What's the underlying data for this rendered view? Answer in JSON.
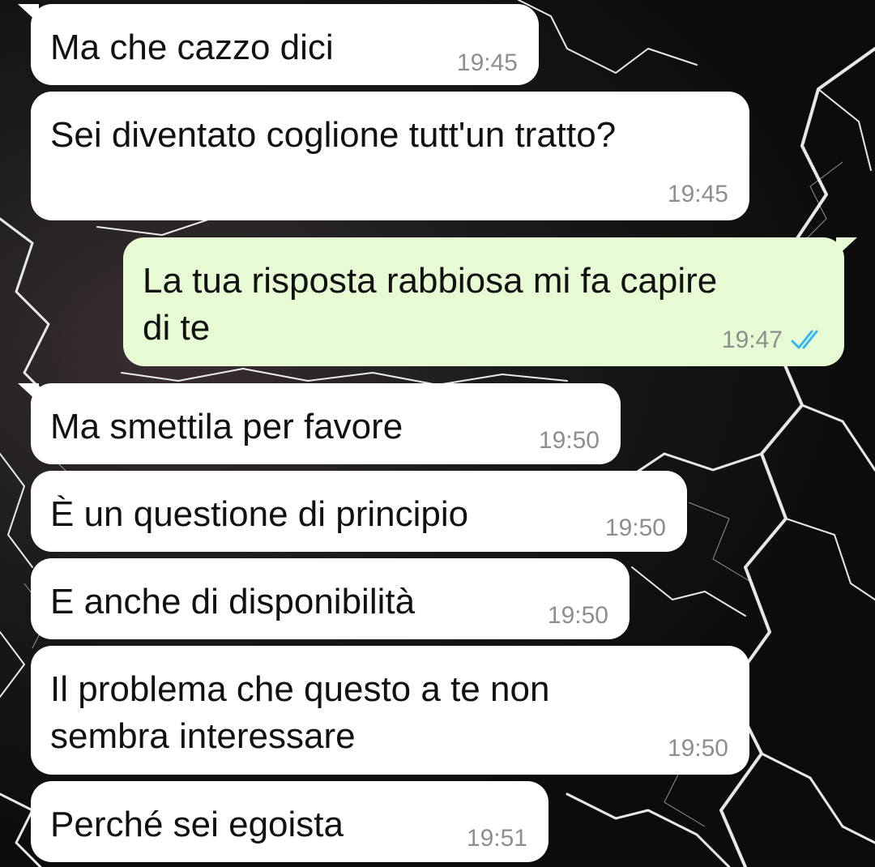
{
  "colors": {
    "incoming_bubble": "#ffffff",
    "outgoing_bubble": "#e6fbd3",
    "read_ticks": "#34b7f1",
    "timestamp": "#8e8e8e"
  },
  "messages": [
    {
      "direction": "incoming",
      "text": "Ma che cazzo dici",
      "time": "19:45"
    },
    {
      "direction": "incoming",
      "text": "Sei diventato coglione tutt'un tratto?",
      "time": "19:45"
    },
    {
      "direction": "outgoing",
      "text": "La tua risposta rabbiosa mi fa capire\ndi te",
      "time": "19:47",
      "status_icon": "double-check-read-icon"
    },
    {
      "direction": "incoming",
      "text": "Ma smettila per favore",
      "time": "19:50"
    },
    {
      "direction": "incoming",
      "text": "È un questione di principio",
      "time": "19:50"
    },
    {
      "direction": "incoming",
      "text": "E anche di disponibilità",
      "time": "19:50"
    },
    {
      "direction": "incoming",
      "text": "Il problema che questo a te non\nsembra interessare",
      "time": "19:50"
    },
    {
      "direction": "incoming",
      "text": "Perché sei egoista",
      "time": "19:51"
    }
  ]
}
